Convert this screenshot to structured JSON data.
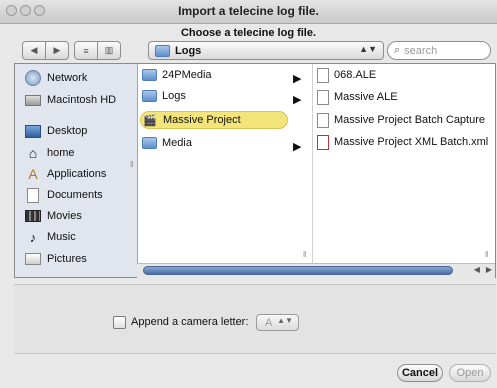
{
  "window": {
    "title": "Import a telecine log file.",
    "prompt": "Choose a telecine log file."
  },
  "toolbar": {
    "back_glyph": "◀",
    "forward_glyph": "▶",
    "list_view_glyph": "≡",
    "column_view_glyph": "▥",
    "location": "Logs",
    "search_placeholder": "search"
  },
  "sidebar": {
    "items": [
      {
        "label": "Network",
        "icon": "globe-icon"
      },
      {
        "label": "Macintosh HD",
        "icon": "hard-drive-icon"
      },
      {
        "label": "Desktop",
        "icon": "desktop-icon"
      },
      {
        "label": "home",
        "icon": "home-icon"
      },
      {
        "label": "Applications",
        "icon": "applications-icon"
      },
      {
        "label": "Documents",
        "icon": "documents-icon"
      },
      {
        "label": "Movies",
        "icon": "movies-icon"
      },
      {
        "label": "Music",
        "icon": "music-icon"
      },
      {
        "label": "Pictures",
        "icon": "pictures-icon"
      }
    ]
  },
  "column1": {
    "items": [
      {
        "label": "24PMedia",
        "kind": "folder",
        "has_children": true
      },
      {
        "label": "Logs",
        "kind": "folder",
        "has_children": true
      },
      {
        "label": "Massive Project",
        "kind": "project",
        "has_children": false,
        "selected": true
      },
      {
        "label": "Media",
        "kind": "folder",
        "has_children": true
      }
    ]
  },
  "column2": {
    "items": [
      {
        "label": "068.ALE",
        "kind": "document"
      },
      {
        "label": "Massive ALE",
        "kind": "document"
      },
      {
        "label": "Massive Project Batch Capture",
        "kind": "document"
      },
      {
        "label": "Massive Project XML Batch.xml",
        "kind": "xml-document"
      }
    ]
  },
  "options": {
    "camera_letter_label": "Append a camera letter:",
    "camera_letter_value": "A",
    "camera_letter_checked": false
  },
  "buttons": {
    "cancel": "Cancel",
    "open": "Open"
  },
  "colors": {
    "selection": "#f3e57a",
    "sidebar_bg": "#e1e6ee",
    "folder_blue": "#5e90cc"
  }
}
